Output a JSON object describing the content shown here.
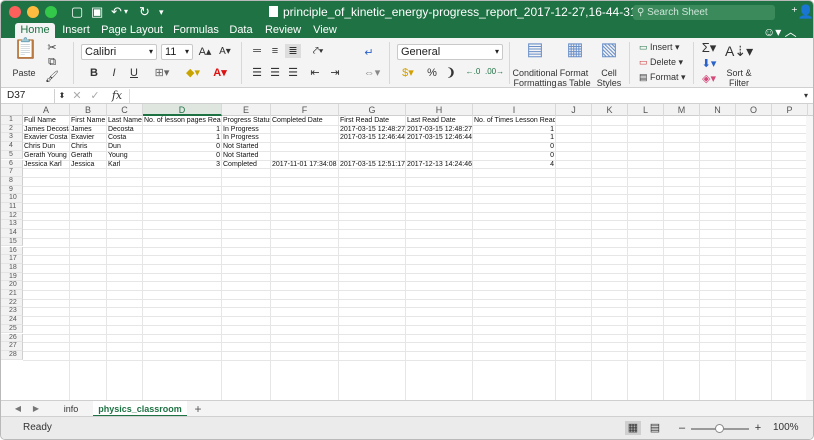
{
  "window": {
    "title": "principle_of_kinetic_energy-progress_report_2017-12-27,16-44-31",
    "search_placeholder": "Search Sheet"
  },
  "ribbon_tabs": [
    "Home",
    "Insert",
    "Page Layout",
    "Formulas",
    "Data",
    "Review",
    "View"
  ],
  "ribbon": {
    "paste_label": "Paste",
    "font_name": "Calibri",
    "font_size": "11",
    "number_format": "General",
    "conditional_formatting": "Conditional",
    "conditional_formatting2": "Formatting",
    "format_as_table": "Format",
    "format_as_table2": "as Table",
    "cell_styles": "Cell",
    "cell_styles2": "Styles",
    "insert_label": "Insert",
    "delete_label": "Delete",
    "format_label": "Format",
    "sort_filter": "Sort &",
    "sort_filter2": "Filter",
    "bold": "B",
    "italic": "I",
    "underline": "U",
    "font_color_glyph": "A",
    "percent": "%"
  },
  "formula_bar": {
    "cell_ref": "D37",
    "fx": "fx",
    "content": ""
  },
  "columns": [
    "A",
    "B",
    "C",
    "D",
    "E",
    "F",
    "G",
    "H",
    "I",
    "J",
    "K",
    "L",
    "M",
    "N",
    "O",
    "P"
  ],
  "selected_column": "D",
  "rows": [
    "1",
    "2",
    "3",
    "4",
    "5",
    "6",
    "7",
    "8",
    "9",
    "10",
    "11",
    "12",
    "13",
    "14",
    "15",
    "16",
    "17",
    "18",
    "19",
    "20",
    "21",
    "22",
    "23",
    "24",
    "25",
    "26",
    "27",
    "28"
  ],
  "table": {
    "headers": [
      "Full Name",
      "First Name",
      "Last Name",
      "No. of lesson pages Read",
      "Progress Status",
      "Completed Date",
      "First Read Date",
      "Last Read Date",
      "No. of Times Lesson Read"
    ],
    "data": [
      [
        "James Decosta",
        "James",
        "Decosta",
        "1",
        "In Progress",
        "",
        "2017-03-15 12:48:27",
        "2017-03-15 12:48:27",
        "1"
      ],
      [
        "Exavier Costa",
        "Exavier",
        "Costa",
        "1",
        "In Progress",
        "",
        "2017-03-15 12:46:44",
        "2017-03-15 12:46:44",
        "1"
      ],
      [
        "Chris Dun",
        "Chris",
        "Dun",
        "0",
        "Not Started",
        "",
        "",
        "",
        "0"
      ],
      [
        "Gerath Young",
        "Gerath",
        "Young",
        "0",
        "Not Started",
        "",
        "",
        "",
        "0"
      ],
      [
        "Jessica Karl",
        "Jessica",
        "Karl",
        "3",
        "Completed",
        "2017-11-01 17:34:08",
        "2017-03-15 12:51:17",
        "2017-12-13 14:24:46",
        "4"
      ]
    ]
  },
  "sheets": [
    "info",
    "physics_classroom"
  ],
  "active_sheet": "physics_classroom",
  "status": {
    "text": "Ready",
    "zoom": "100%"
  }
}
